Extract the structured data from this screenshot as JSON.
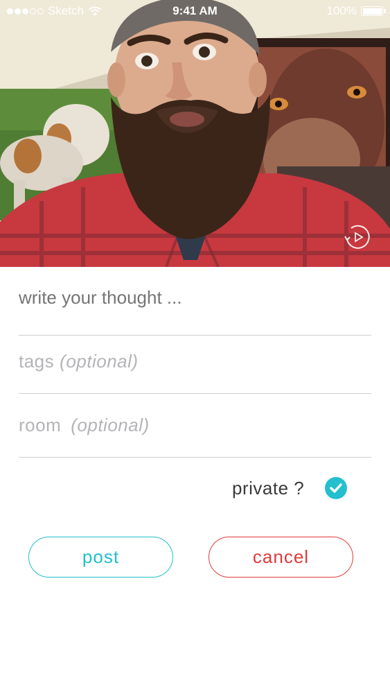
{
  "status_bar": {
    "carrier": "Sketch",
    "time": "9:41 AM",
    "battery": "100%",
    "signal_bars_filled": 3,
    "signal_bars_total": 5
  },
  "media": {
    "replay_icon": "replay-icon"
  },
  "form": {
    "thought_placeholder": "write your thought ...",
    "tags_label": "tags",
    "tags_optional": "(optional)",
    "room_label": "room",
    "room_optional": "(optional)",
    "private_label": "private ?",
    "private_checked": true
  },
  "buttons": {
    "post_label": "post",
    "cancel_label": "cancel"
  },
  "colors": {
    "accent_teal": "#22bfcc",
    "cancel_red": "#e0393b",
    "placeholder_gray": "#b4b4b8"
  }
}
